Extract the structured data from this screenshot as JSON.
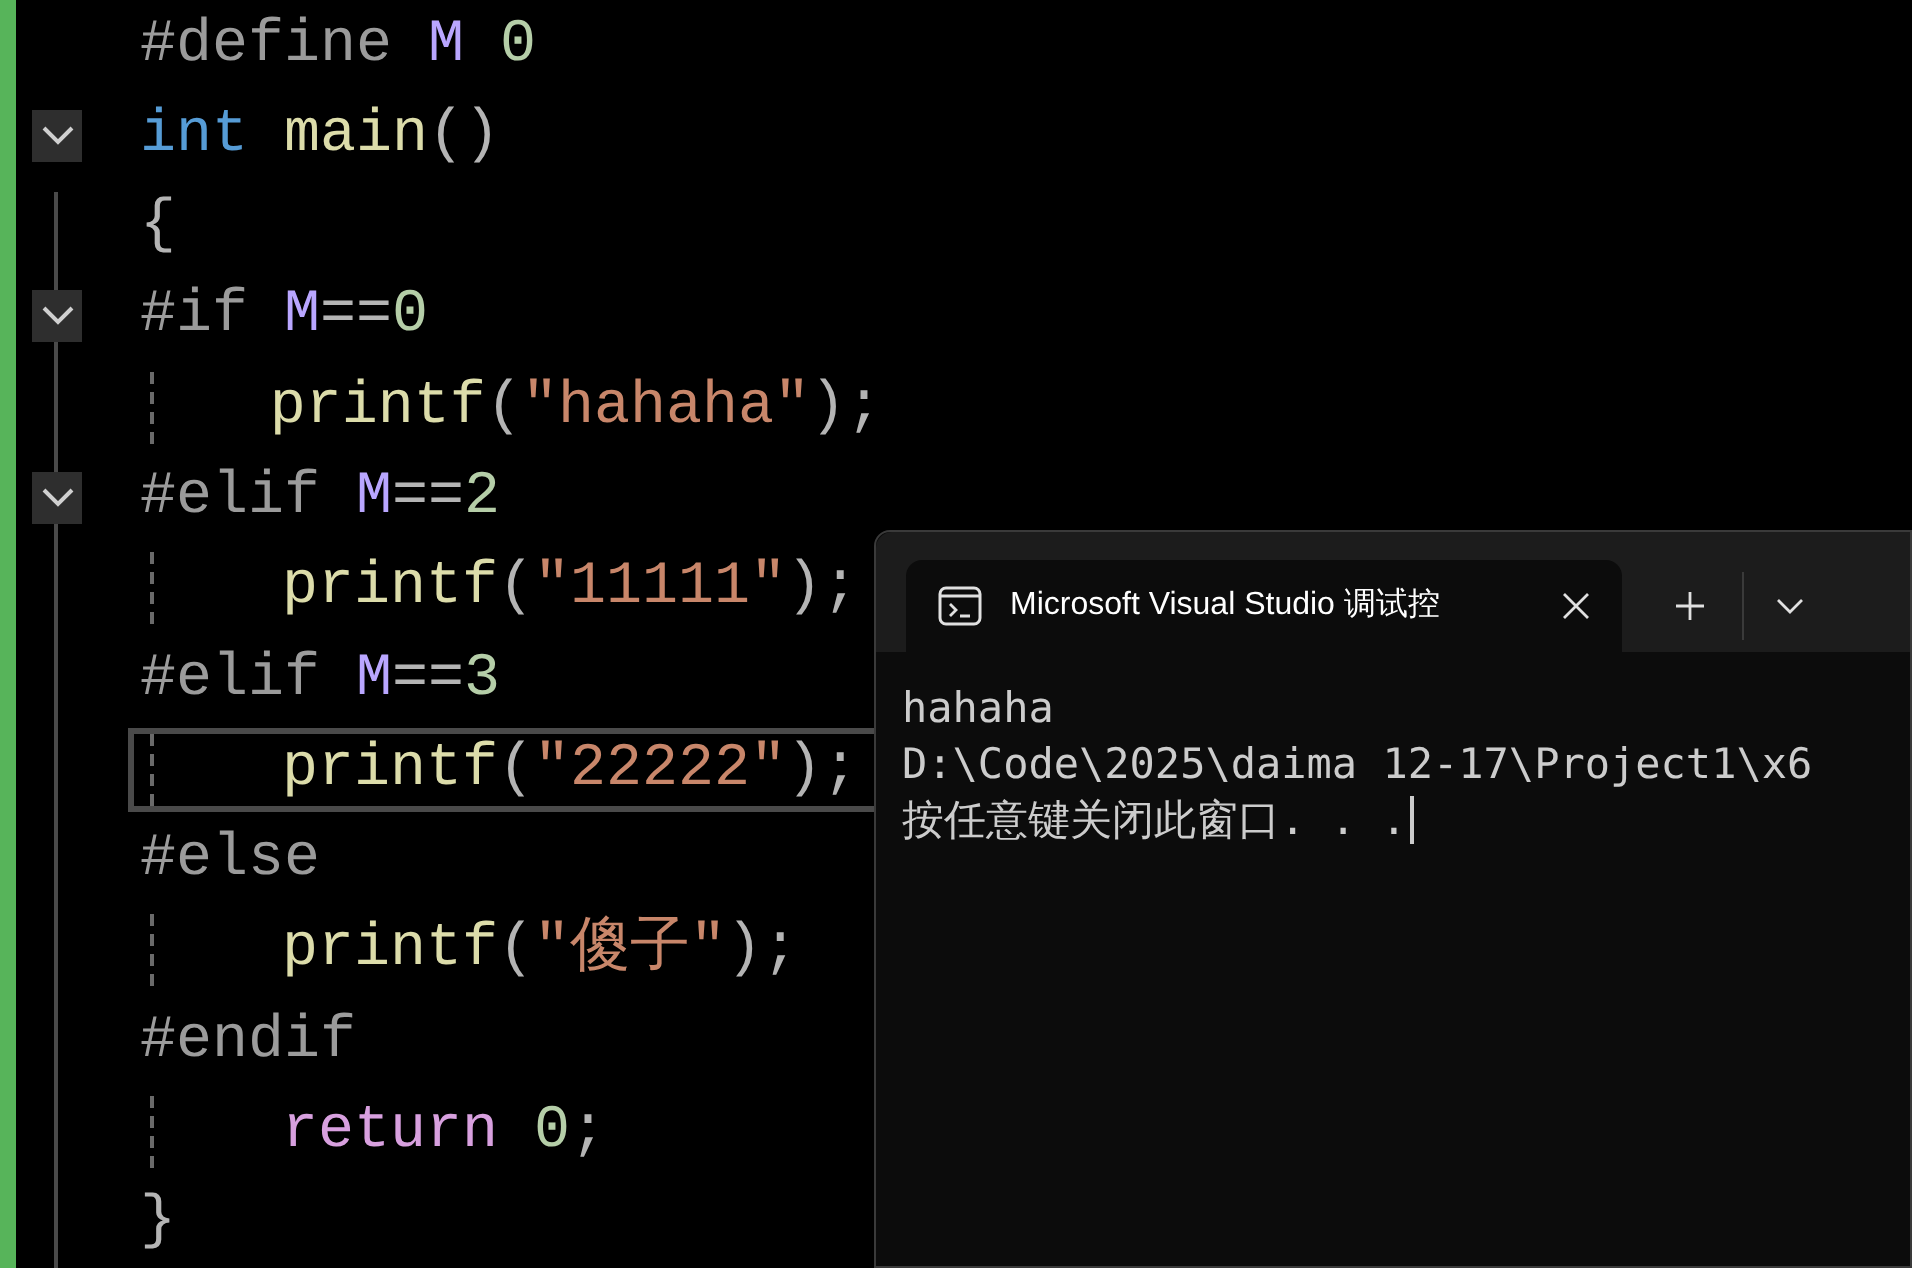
{
  "editor": {
    "lines": [
      {
        "kind": "plain",
        "current": false,
        "tokens": [
          {
            "kind": "directive",
            "text": "#define"
          },
          {
            "kind": "macro",
            "text": " M"
          },
          {
            "kind": "number",
            "text": " 0"
          }
        ]
      },
      {
        "kind": "fold",
        "expanded": true,
        "current": false,
        "tokens": [
          {
            "kind": "keyword",
            "text": "int"
          },
          {
            "kind": "function",
            "text": " main"
          },
          {
            "kind": "plain",
            "text": "()"
          }
        ]
      },
      {
        "kind": "plain",
        "current": false,
        "tokens": [
          {
            "kind": "plain",
            "text": "{"
          }
        ]
      },
      {
        "kind": "fold",
        "expanded": true,
        "current": false,
        "tokens": [
          {
            "kind": "directive",
            "text": "#if"
          },
          {
            "kind": "macro",
            "text": " M"
          },
          {
            "kind": "plain",
            "text": "=="
          },
          {
            "kind": "number",
            "text": "0"
          }
        ]
      },
      {
        "kind": "indented",
        "current": false,
        "tokens": [
          {
            "kind": "function",
            "text": "printf"
          },
          {
            "kind": "plain",
            "text": "("
          },
          {
            "kind": "string",
            "text": "\"hahaha\""
          },
          {
            "kind": "plain",
            "text": ");"
          }
        ]
      },
      {
        "kind": "fold",
        "expanded": true,
        "current": false,
        "tokens": [
          {
            "kind": "directive",
            "text": "#elif"
          },
          {
            "kind": "macro",
            "text": " M"
          },
          {
            "kind": "plain",
            "text": "=="
          },
          {
            "kind": "number",
            "text": "2"
          }
        ]
      },
      {
        "kind": "indented",
        "current": false,
        "tokens": [
          {
            "kind": "function",
            "text": "printf"
          },
          {
            "kind": "plain",
            "text": "("
          },
          {
            "kind": "string",
            "text": "\"11111\""
          },
          {
            "kind": "plain",
            "text": ");"
          }
        ]
      },
      {
        "kind": "plain",
        "current": false,
        "tokens": [
          {
            "kind": "directive",
            "text": "#elif"
          },
          {
            "kind": "macro",
            "text": " M"
          },
          {
            "kind": "plain",
            "text": "=="
          },
          {
            "kind": "number",
            "text": "3"
          }
        ]
      },
      {
        "kind": "indented",
        "current": true,
        "tokens": [
          {
            "kind": "function",
            "text": "printf"
          },
          {
            "kind": "plain",
            "text": "("
          },
          {
            "kind": "string",
            "text": "\"22222\""
          },
          {
            "kind": "plain",
            "text": ");"
          }
        ]
      },
      {
        "kind": "plain",
        "current": false,
        "tokens": [
          {
            "kind": "directive",
            "text": "#else"
          }
        ]
      },
      {
        "kind": "indented",
        "current": false,
        "tokens": [
          {
            "kind": "function",
            "text": "printf"
          },
          {
            "kind": "plain",
            "text": "("
          },
          {
            "kind": "string",
            "text": "\"傻子\""
          },
          {
            "kind": "plain",
            "text": ");"
          }
        ]
      },
      {
        "kind": "plain",
        "current": false,
        "tokens": [
          {
            "kind": "directive",
            "text": "#endif"
          }
        ]
      },
      {
        "kind": "indented",
        "current": false,
        "tokens": [
          {
            "kind": "control",
            "text": "return"
          },
          {
            "kind": "number",
            "text": " 0"
          },
          {
            "kind": "plain",
            "text": ";"
          }
        ]
      },
      {
        "kind": "plain",
        "current": false,
        "tokens": [
          {
            "kind": "plain",
            "text": "}"
          }
        ]
      }
    ]
  },
  "terminal": {
    "tab": {
      "title": "Microsoft Visual Studio 调试控",
      "selected": true
    },
    "output": [
      "hahaha",
      "D:\\Code\\2025\\daima 12-17\\Project1\\x6",
      "按任意键关闭此窗口. . ."
    ]
  }
}
